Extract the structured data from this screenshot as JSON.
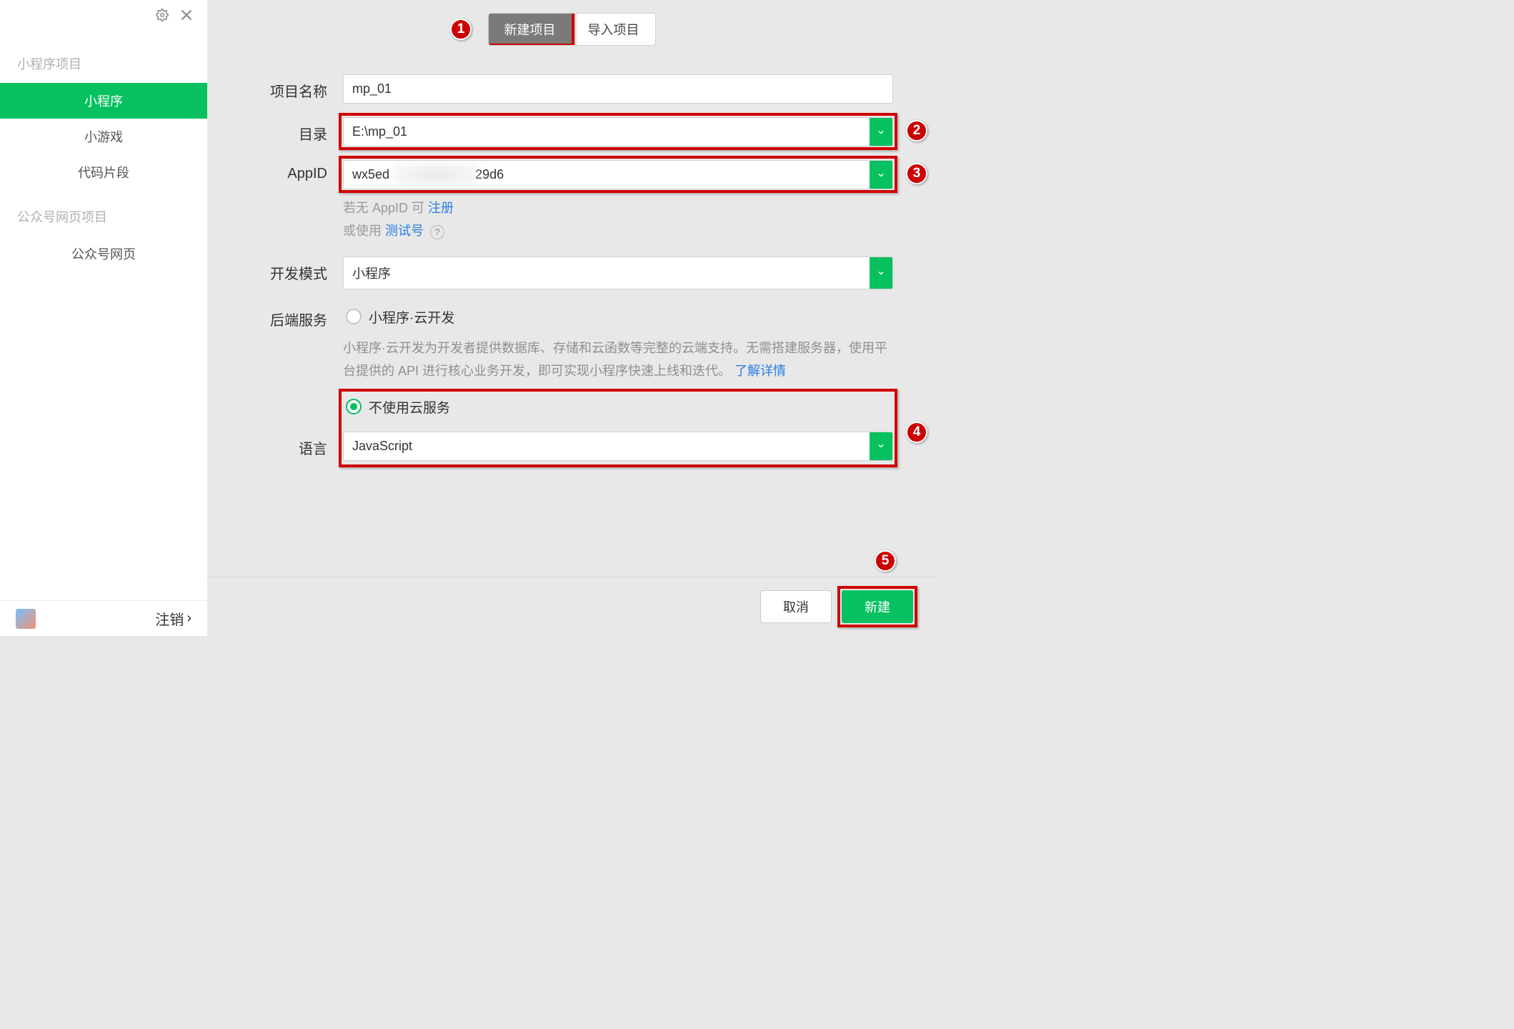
{
  "sidebar": {
    "sections": [
      {
        "heading": "小程序项目",
        "items": [
          "小程序",
          "小游戏",
          "代码片段"
        ]
      },
      {
        "heading": "公众号网页项目",
        "items": [
          "公众号网页"
        ]
      }
    ],
    "logout": "注销"
  },
  "tabs": {
    "new_project": "新建项目",
    "import_project": "导入项目"
  },
  "form": {
    "project_name": {
      "label": "项目名称",
      "value": "mp_01"
    },
    "directory": {
      "label": "目录",
      "value": "E:\\mp_01"
    },
    "appid": {
      "label": "AppID",
      "value_prefix": "wx5ed",
      "value_suffix": "29d6",
      "help_a": "若无 AppID 可 ",
      "help_a_link": "注册",
      "help_b": "或使用 ",
      "help_b_link": "测试号"
    },
    "dev_mode": {
      "label": "开发模式",
      "value": "小程序"
    },
    "backend": {
      "label": "后端服务",
      "cloud_option": "小程序·云开发",
      "cloud_desc": "小程序·云开发为开发者提供数据库、存储和云函数等完整的云端支持。无需搭建服务器，使用平台提供的 API 进行核心业务开发，即可实现小程序快速上线和迭代。",
      "cloud_link": "了解详情",
      "nocloud_option": "不使用云服务"
    },
    "language": {
      "label": "语言",
      "value": "JavaScript"
    }
  },
  "footer": {
    "cancel": "取消",
    "create": "新建"
  },
  "annotations": [
    "1",
    "2",
    "3",
    "4",
    "5"
  ],
  "colors": {
    "accent": "#07c160",
    "highlight": "#d00000"
  }
}
